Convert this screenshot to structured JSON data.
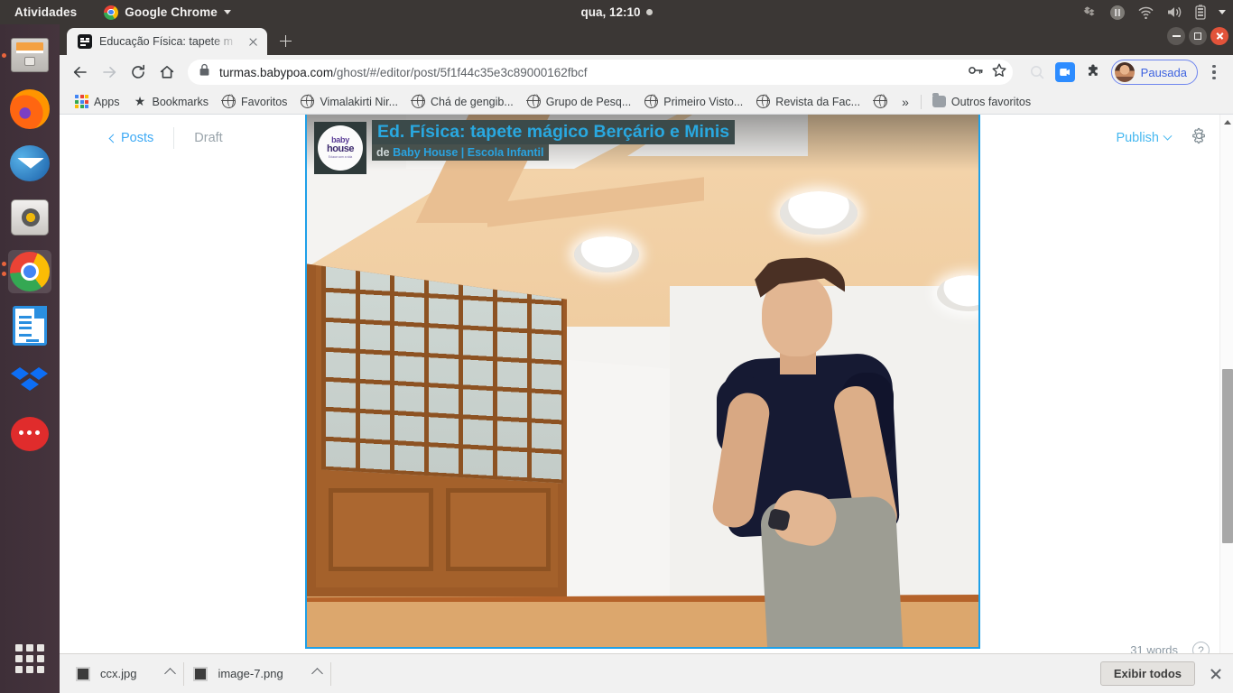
{
  "system_bar": {
    "activities_label": "Activities",
    "activities_label_localized": "Atividades",
    "app_menu_label": "Google Chrome",
    "clock": "qua, 12:10",
    "tray_icons": [
      "dropbox-icon",
      "media-pause-icon",
      "wifi-icon",
      "volume-icon",
      "battery-icon",
      "system-menu-caret-icon"
    ]
  },
  "dock": {
    "items": [
      {
        "name": "files",
        "label": "Files"
      },
      {
        "name": "firefox",
        "label": "Firefox"
      },
      {
        "name": "thunderbird",
        "label": "Thunderbird"
      },
      {
        "name": "rhythmbox",
        "label": "Rhythmbox"
      },
      {
        "name": "chrome",
        "label": "Google Chrome",
        "active": true
      },
      {
        "name": "libreoffice-impress",
        "label": "LibreOffice Impress"
      },
      {
        "name": "dropbox",
        "label": "Dropbox"
      },
      {
        "name": "rocketchat",
        "label": "Rocket.Chat"
      }
    ],
    "show_apps_label": "Show Applications"
  },
  "browser": {
    "tab": {
      "title": "Educação Física: tapete m",
      "favicon": "ghost-icon",
      "close_label": "Close tab"
    },
    "new_tab_label": "New tab",
    "window_controls": [
      "minimize",
      "maximize",
      "close"
    ],
    "nav": {
      "back": "Back",
      "forward": "Forward",
      "reload": "Reload",
      "home": "Home"
    },
    "omnibox": {
      "lock": "secure-lock-icon",
      "url_host": "turmas.babypoa.com",
      "url_path": "/ghost/#/editor/post/5f1f44c35e3c89000162fbcf",
      "url_full": "turmas.babypoa.com/ghost/#/editor/post/5f1f44c35e3c89000162fbcf",
      "icons": [
        "password-key-icon",
        "bookmark-star-icon"
      ]
    },
    "extensions": {
      "search_icon": "search-disabled-icon",
      "zoom_icon": "zoom-video-icon",
      "puzzle_icon": "extensions-puzzle-icon"
    },
    "profile": {
      "name": "Pausada",
      "avatar": "user-avatar"
    },
    "menu_label": "Customize and control Google Chrome",
    "bookmarks": [
      {
        "label": "Apps",
        "icon": "apps-grid-icon"
      },
      {
        "label": "Bookmarks",
        "icon": "star-icon"
      },
      {
        "label": "Favoritos",
        "icon": "globe-icon"
      },
      {
        "label": "Vimalakirti Nir...",
        "icon": "globe-icon"
      },
      {
        "label": "Chá de gengib...",
        "icon": "globe-icon"
      },
      {
        "label": "Grupo de Pesq...",
        "icon": "globe-icon"
      },
      {
        "label": "Primeiro Visto...",
        "icon": "globe-icon"
      },
      {
        "label": "Revista da Fac...",
        "icon": "globe-icon"
      },
      {
        "label": "",
        "icon": "globe-icon"
      }
    ],
    "bookmarks_overflow": "»",
    "other_bookmarks": {
      "label": "Outros favoritos",
      "icon": "folder-icon"
    }
  },
  "editor": {
    "back_label": "Posts",
    "status_label": "Draft",
    "publish_label": "Publish",
    "settings_icon": "gear-icon",
    "word_count": "31 words",
    "help_icon": "help-question-icon"
  },
  "video_embed": {
    "channel_logo": {
      "line1": "baby",
      "line2": "house",
      "line3": "Educar com a vida"
    },
    "title": "Ed. Física: tapete mágico Berçário e Minis",
    "byline_prefix": "de",
    "byline_author": "Baby House | Escola Infantil",
    "selected": true
  },
  "download_shelf": {
    "items": [
      {
        "filename": "ccx.jpg",
        "menu_icon": "chevron-up-icon"
      },
      {
        "filename": "image-7.png",
        "menu_icon": "chevron-up-icon"
      }
    ],
    "show_all_label": "Exibir todos",
    "close_label": "Close"
  },
  "scrollbar": {
    "up_arrow": "scroll-up-arrow",
    "down_arrow": "scroll-down-arrow"
  },
  "colors": {
    "ghost_accent": "#3eaaf5",
    "embed_selection": "#1fa0e8",
    "video_title": "#29a8e0",
    "chrome_toolbar": "#f1f1f1",
    "gnome_bar": "#3b3735",
    "dock": "#45343d",
    "profile_pill": "#6f86ef"
  }
}
